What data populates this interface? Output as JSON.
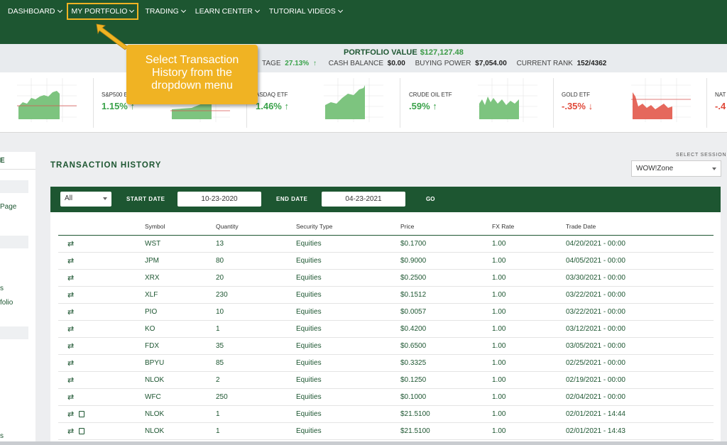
{
  "nav": [
    {
      "label": "DASHBOARD"
    },
    {
      "label": "MY PORTFOLIO"
    },
    {
      "label": "TRADING"
    },
    {
      "label": "LEARN CENTER"
    },
    {
      "label": "TUTORIAL VIDEOS"
    }
  ],
  "summary": {
    "portfolio_value_label": "PORTFOLIO VALUE",
    "portfolio_value": "$127,127.48",
    "percentage_label": "TAGE",
    "percentage": "27.13%",
    "cash_balance_label": "CASH BALANCE",
    "cash_balance": "$0.00",
    "buying_power_label": "BUYING POWER",
    "buying_power": "$7,054.00",
    "current_rank_label": "CURRENT RANK",
    "current_rank": "152/4362"
  },
  "tickers": [
    {
      "label": "S&P500 E",
      "change": "1.15%",
      "direction": "up",
      "chart_color": "#7dc47f"
    },
    {
      "label": "ASDAQ ETF",
      "change": "1.46%",
      "direction": "up",
      "chart_color": "#7dc47f"
    },
    {
      "label": "CRUDE OIL ETF",
      "change": ".59%",
      "direction": "up",
      "chart_color": "#7dc47f"
    },
    {
      "label": "GOLD ETF",
      "change": "-.35%",
      "direction": "down",
      "chart_color": "#e5685c"
    },
    {
      "label": "NAT",
      "change": "-.4",
      "direction": "down",
      "chart_color": "#e5685c"
    }
  ],
  "callout": {
    "line1": "Select Transaction",
    "line2": "History from the",
    "line3": "dropdown menu",
    "color": "#f0b323"
  },
  "sidebar": {
    "top": "E",
    "items": [
      "Page",
      "s",
      "folio",
      "s"
    ]
  },
  "main": {
    "title": "TRANSACTION HISTORY",
    "session_label": "SELECT SESSION",
    "session_value": "WOW!Zone"
  },
  "filters": {
    "type_value": "All",
    "start_label": "START DATE",
    "start_value": "10-23-2020",
    "end_label": "END DATE",
    "end_value": "04-23-2021",
    "go_label": "GO"
  },
  "table": {
    "headers": [
      "Symbol",
      "Quantity",
      "Security Type",
      "Price",
      "FX Rate",
      "Trade Date"
    ],
    "rows": [
      {
        "note": false,
        "symbol": "WST",
        "qty": "13",
        "type": "Equities",
        "price": "$0.1700",
        "fx": "1.00",
        "date": "04/20/2021 - 00:00"
      },
      {
        "note": false,
        "symbol": "JPM",
        "qty": "80",
        "type": "Equities",
        "price": "$0.9000",
        "fx": "1.00",
        "date": "04/05/2021 - 00:00"
      },
      {
        "note": false,
        "symbol": "XRX",
        "qty": "20",
        "type": "Equities",
        "price": "$0.2500",
        "fx": "1.00",
        "date": "03/30/2021 - 00:00"
      },
      {
        "note": false,
        "symbol": "XLF",
        "qty": "230",
        "type": "Equities",
        "price": "$0.1512",
        "fx": "1.00",
        "date": "03/22/2021 - 00:00"
      },
      {
        "note": false,
        "symbol": "PIO",
        "qty": "10",
        "type": "Equities",
        "price": "$0.0057",
        "fx": "1.00",
        "date": "03/22/2021 - 00:00"
      },
      {
        "note": false,
        "symbol": "KO",
        "qty": "1",
        "type": "Equities",
        "price": "$0.4200",
        "fx": "1.00",
        "date": "03/12/2021 - 00:00"
      },
      {
        "note": false,
        "symbol": "FDX",
        "qty": "35",
        "type": "Equities",
        "price": "$0.6500",
        "fx": "1.00",
        "date": "03/05/2021 - 00:00"
      },
      {
        "note": false,
        "symbol": "BPYU",
        "qty": "85",
        "type": "Equities",
        "price": "$0.3325",
        "fx": "1.00",
        "date": "02/25/2021 - 00:00"
      },
      {
        "note": false,
        "symbol": "NLOK",
        "qty": "2",
        "type": "Equities",
        "price": "$0.1250",
        "fx": "1.00",
        "date": "02/19/2021 - 00:00"
      },
      {
        "note": false,
        "symbol": "WFC",
        "qty": "250",
        "type": "Equities",
        "price": "$0.1000",
        "fx": "1.00",
        "date": "02/04/2021 - 00:00"
      },
      {
        "note": true,
        "symbol": "NLOK",
        "qty": "1",
        "type": "Equities",
        "price": "$21.5100",
        "fx": "1.00",
        "date": "02/01/2021 - 14:44"
      },
      {
        "note": true,
        "symbol": "NLOK",
        "qty": "1",
        "type": "Equities",
        "price": "$21.5100",
        "fx": "1.00",
        "date": "02/01/2021 - 14:43"
      }
    ]
  },
  "colors": {
    "brand": "#1d5631",
    "up": "#3aa24a",
    "down": "#e04a3a",
    "highlight": "#f0b323"
  }
}
